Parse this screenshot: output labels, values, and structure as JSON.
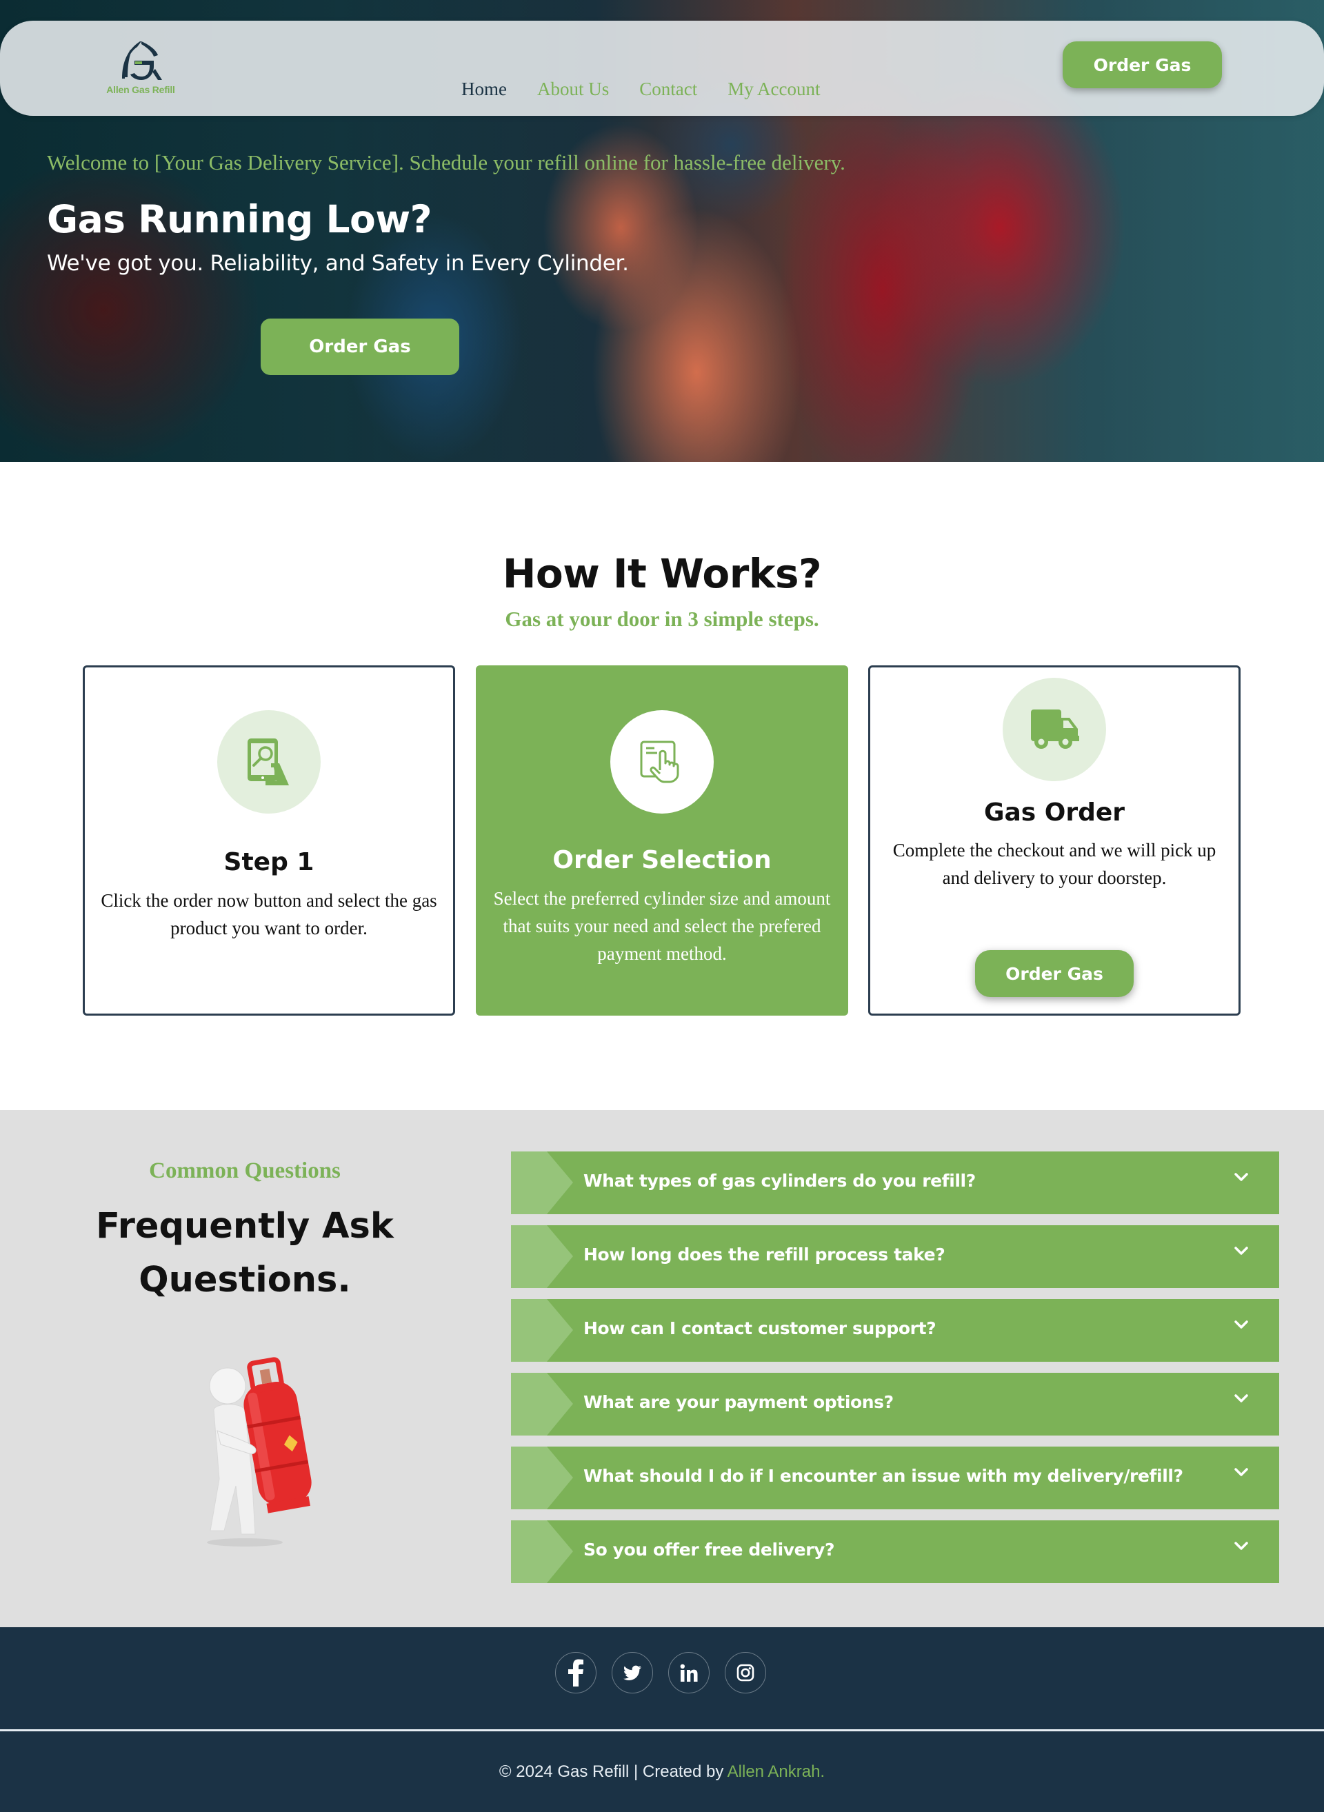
{
  "colors": {
    "accent": "#7cb257",
    "accent_light": "#e3efdd",
    "dark_navy": "#1b3245",
    "faq_bg": "#dfdfdf",
    "card_border": "#2c3e50"
  },
  "header": {
    "logo_text": "Allen Gas Refill",
    "nav": [
      {
        "label": "Home",
        "active": true
      },
      {
        "label": "About Us",
        "active": false
      },
      {
        "label": "Contact",
        "active": false
      },
      {
        "label": "My Account",
        "active": false
      }
    ],
    "cta_label": "Order Gas"
  },
  "hero": {
    "welcome": "Welcome to [Your Gas Delivery Service]. Schedule your refill online for hassle-free delivery.",
    "title": "Gas Running Low?",
    "subtitle": "We've got you. Reliability, and Safety in Every Cylinder.",
    "cta_label": "Order Gas"
  },
  "how_it_works": {
    "title": "How It Works?",
    "subtitle": "Gas at your door in 3 simple steps.",
    "steps": [
      {
        "icon": "tablet-search-icon",
        "title": "Step 1",
        "text": "Click the order now button and select the gas product you want to order."
      },
      {
        "icon": "touch-select-icon",
        "title": "Order Selection",
        "text": "Select the preferred cylinder size and amount that suits your need and select the prefered payment method."
      },
      {
        "icon": "delivery-truck-icon",
        "title": "Gas Order",
        "text": "Complete the checkout and we will pick up and delivery to your doorstep.",
        "button_label": "Order Gas"
      }
    ]
  },
  "faq": {
    "kicker": "Common Questions",
    "title": "Frequently Ask Questions.",
    "items": [
      {
        "question": "What types of gas cylinders do you refill?"
      },
      {
        "question": "How long does the refill process take?"
      },
      {
        "question": "How can I contact customer support?"
      },
      {
        "question": "What are your payment options?"
      },
      {
        "question": "What should I do if I encounter an issue with my delivery/refill?"
      },
      {
        "question": "So you offer free delivery?"
      }
    ]
  },
  "footer": {
    "socials": [
      "facebook-icon",
      "twitter-icon",
      "linkedin-icon",
      "instagram-icon"
    ],
    "copyright_prefix": "© 2024 Gas Refill | Created by ",
    "author": "Allen Ankrah."
  }
}
